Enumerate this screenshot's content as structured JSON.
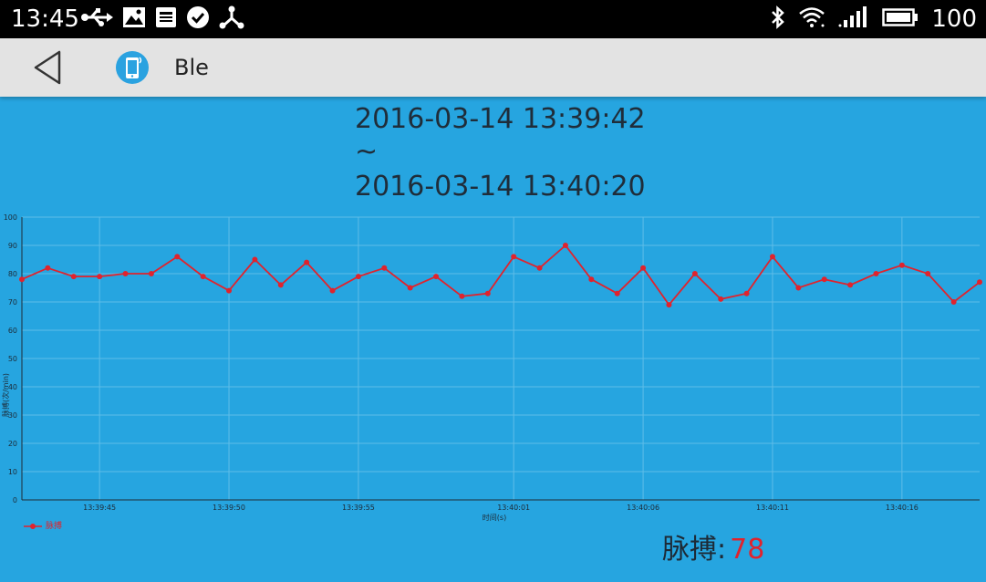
{
  "status_bar": {
    "time": "13:45",
    "battery_level": "100",
    "left_icons": [
      "usb-icon",
      "image-icon",
      "news-icon",
      "check-circle-icon",
      "share-icon"
    ],
    "right_icons": [
      "bluetooth-icon",
      "wifi-icon",
      "signal-3g-icon",
      "battery-icon"
    ]
  },
  "action_bar": {
    "title": "Ble",
    "back_icon": "back-triangle-icon",
    "app_icon": "phone-app-icon"
  },
  "range": {
    "start": "2016-03-14 13:39:42",
    "separator": "~",
    "end": "2016-03-14 13:40:20"
  },
  "colors": {
    "background": "#26a5e0",
    "line": "#e0232d",
    "grid": "#5fbde8"
  },
  "chart_data": {
    "type": "line",
    "xlabel": "时间(s)",
    "ylabel": "脉搏(次/min)",
    "ylim": [
      0,
      100
    ],
    "yticks": [
      0,
      10,
      20,
      30,
      40,
      50,
      60,
      70,
      80,
      90,
      100
    ],
    "x_tick_labels": [
      {
        "index": 3,
        "label": "13:39:45"
      },
      {
        "index": 8,
        "label": "13:39:50"
      },
      {
        "index": 13,
        "label": "13:39:55"
      },
      {
        "index": 19,
        "label": "13:40:01"
      },
      {
        "index": 24,
        "label": "13:40:06"
      },
      {
        "index": 29,
        "label": "13:40:11"
      },
      {
        "index": 34,
        "label": "13:40:16"
      }
    ],
    "grid": true,
    "legend": "bottom-left",
    "series": [
      {
        "name": "脉搏",
        "x": [
          "13:39:42",
          "13:39:43",
          "13:39:44",
          "13:39:45",
          "13:39:46",
          "13:39:47",
          "13:39:48",
          "13:39:49",
          "13:39:50",
          "13:39:51",
          "13:39:52",
          "13:39:53",
          "13:39:54",
          "13:39:55",
          "13:39:56",
          "13:39:57",
          "13:39:58",
          "13:39:59",
          "13:40:00",
          "13:40:01",
          "13:40:02",
          "13:40:03",
          "13:40:04",
          "13:40:05",
          "13:40:06",
          "13:40:07",
          "13:40:08",
          "13:40:09",
          "13:40:10",
          "13:40:11",
          "13:40:12",
          "13:40:13",
          "13:40:14",
          "13:40:15",
          "13:40:16",
          "13:40:17",
          "13:40:18",
          "13:40:19"
        ],
        "values": [
          78,
          82,
          79,
          79,
          80,
          80,
          86,
          79,
          74,
          85,
          76,
          84,
          74,
          79,
          82,
          75,
          79,
          72,
          73,
          86,
          82,
          90,
          78,
          73,
          82,
          69,
          80,
          71,
          73,
          86,
          75,
          78,
          76,
          80,
          83,
          80,
          70,
          77
        ]
      }
    ]
  },
  "readout": {
    "label": "脉搏:",
    "value": "78"
  }
}
